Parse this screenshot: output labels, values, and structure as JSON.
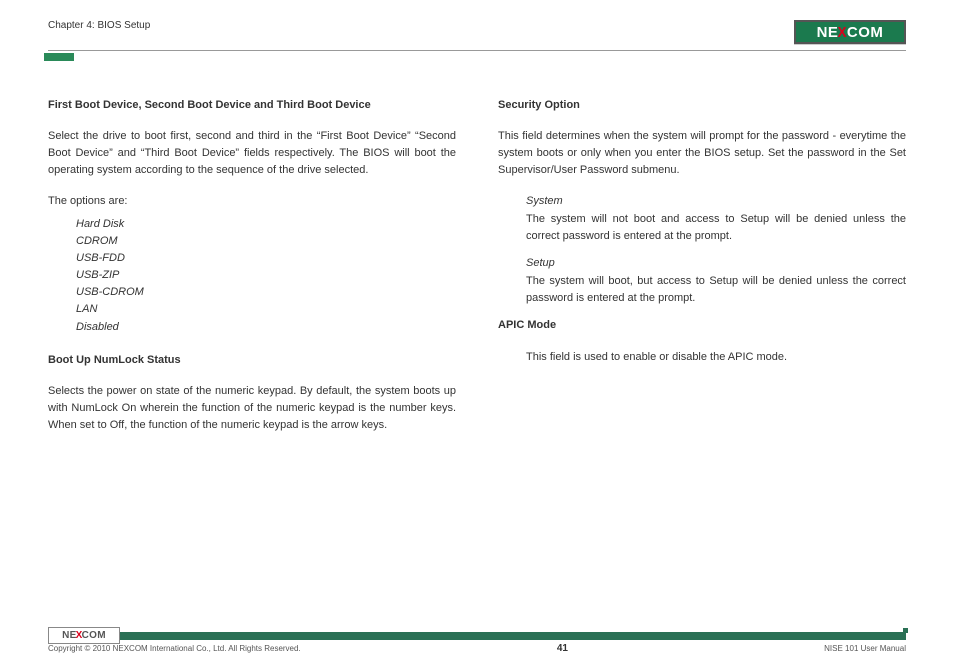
{
  "header": {
    "chapter": "Chapter 4: BIOS Setup",
    "logo_pre": "NE",
    "logo_x": "X",
    "logo_post": "COM"
  },
  "left": {
    "title1": "First Boot Device, Second Boot Device and Third Boot Device",
    "para1": "Select the drive to boot first, second and third in the “First Boot Device” “Second Boot Device” and “Third Boot Device” fields respectively. The BIOS will boot the operating system according to the sequence of the drive selected.",
    "options_intro": "The options are:",
    "options": [
      "Hard Disk",
      "CDROM",
      "USB-FDD",
      "USB-ZIP",
      "USB-CDROM",
      "LAN",
      "Disabled"
    ],
    "title2": "Boot Up NumLock Status",
    "para2": "Selects the power on state of the numeric keypad. By default, the system boots up with NumLock On wherein the function of the numeric keypad is the number keys. When set to Off, the function of the numeric keypad is the arrow keys."
  },
  "right": {
    "title1": "Security Option",
    "para1": "This field determines when the system will prompt for the password - everytime the system boots or only when you enter the BIOS setup. Set the password in the Set Supervisor/User Password submenu.",
    "system_label": "System",
    "system_text": "The system will not boot and access to Setup will be denied unless the correct password is entered at the prompt.",
    "setup_label": "Setup",
    "setup_text": "The system will boot, but access to Setup will be denied unless the correct password is entered at the prompt.",
    "title2": "APIC Mode",
    "apic_text": "This field is used to enable or disable the APIC mode."
  },
  "footer": {
    "logo_pre": "NE",
    "logo_x": "X",
    "logo_post": "COM",
    "copyright": "Copyright © 2010 NEXCOM International Co., Ltd. All Rights Reserved.",
    "page": "41",
    "manual": "NISE 101 User Manual"
  }
}
